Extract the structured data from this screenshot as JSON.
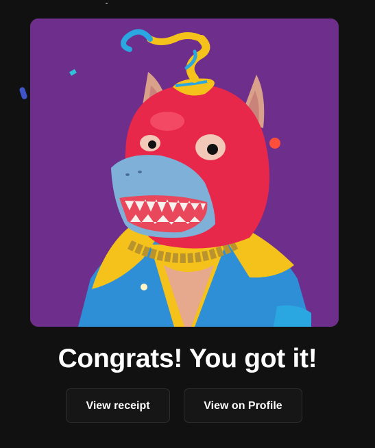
{
  "artwork": {
    "alt": "3D cartoon character: red dog-like creature with a blue shark mouth, yellow collar and blue jacket, gold chain, wearing a curly ribbon party hat on a purple background",
    "colors": {
      "background": "#6e2f8c",
      "head": "#e8284a",
      "snout": "#7fb0d8",
      "collar": "#f4c21a",
      "jacket": "#2f8fd6",
      "chain": "#b9932d",
      "ears": "#d9a08a"
    }
  },
  "headline": "Congrats! You got it!",
  "actions": {
    "view_receipt": "View receipt",
    "view_on_profile": "View on Profile"
  }
}
